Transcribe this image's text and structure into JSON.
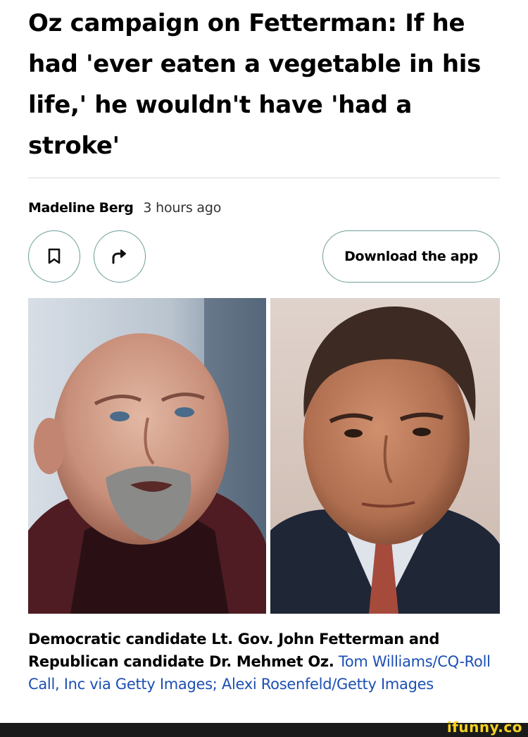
{
  "article": {
    "headline": "Oz campaign on Fetterman: If he had 'ever eaten a vegetable in his life,' he wouldn't have 'had a stroke'",
    "author": "Madeline Berg",
    "time": "3 hours ago"
  },
  "actions": {
    "save_icon": "bookmark-icon",
    "share_icon": "share-arrow-icon",
    "download_label": "Download the app"
  },
  "caption": {
    "text": "Democratic candidate Lt. Gov. John Fetterman and Republican candidate Dr. Mehmet Oz.",
    "credit": "Tom Williams/CQ-Roll Call, Inc via Getty Images; Alexi Rosenfeld/Getty Images"
  },
  "watermark": {
    "text": "ifunny.co"
  },
  "colors": {
    "button_border": "#6b9e98",
    "credit_link": "#1c4fb4",
    "watermark": "#f7d11e"
  }
}
